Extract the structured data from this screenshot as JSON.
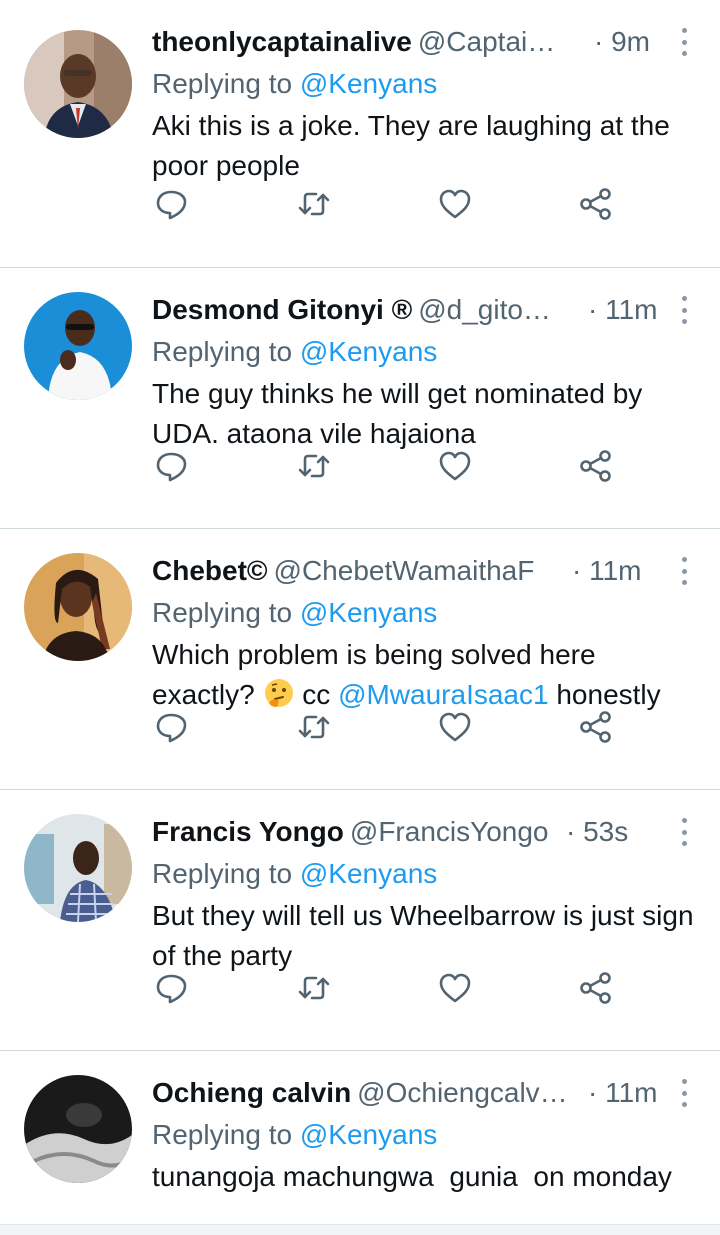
{
  "colors": {
    "link": "#1d9bf0",
    "secondary": "#536471",
    "text": "#0f1419",
    "divider": "#cfd9de"
  },
  "tweets": [
    {
      "name": "theonlycaptainalive",
      "handle": "@Captai…",
      "time": "· 9m",
      "replying_prefix": "Replying to ",
      "replying_to": "@Kenyans",
      "text_parts": [
        "Aki this is a joke. They are laughing at the poor people"
      ],
      "avatar": "man-in-suit"
    },
    {
      "name": "Desmond Gitonyi ®",
      "handle": "@d_gito…",
      "time": "· 11m",
      "replying_prefix": "Replying to ",
      "replying_to": "@Kenyans",
      "text_parts": [
        "The guy thinks he will get nominated by UDA. ataona vile hajaiona"
      ],
      "avatar": "man-white-shirt-blue-bg"
    },
    {
      "name": "Chebet©",
      "handle": "@ChebetWamaithaF",
      "time": "· 11m",
      "replying_prefix": "Replying to ",
      "replying_to": "@Kenyans",
      "text_before": "Which problem is being solved here exactly? ",
      "emoji": "thinking-face",
      "text_cc": " cc ",
      "text_mention": "@MwauraIsaac1",
      "text_after": " honestly",
      "avatar": "woman-locs"
    },
    {
      "name": "Francis Yongo",
      "handle": "@FrancisYongo",
      "time": "· 53s",
      "replying_prefix": "Replying to ",
      "replying_to": "@Kenyans",
      "text_parts": [
        "But they will tell us Wheelbarrow is just sign of the party"
      ],
      "avatar": "man-checked-shirt"
    },
    {
      "name": "Ochieng calvin",
      "handle": "@Ochiengcalv…",
      "time": "· 11m",
      "replying_prefix": "Replying to ",
      "replying_to": "@Kenyans",
      "text_parts": [
        "tunangoja machungwa  gunia  on monday"
      ],
      "avatar": "dark-photo"
    }
  ],
  "actions": {
    "reply": "reply-icon",
    "retweet": "retweet-icon",
    "like": "heart-icon",
    "share": "share-icon"
  }
}
